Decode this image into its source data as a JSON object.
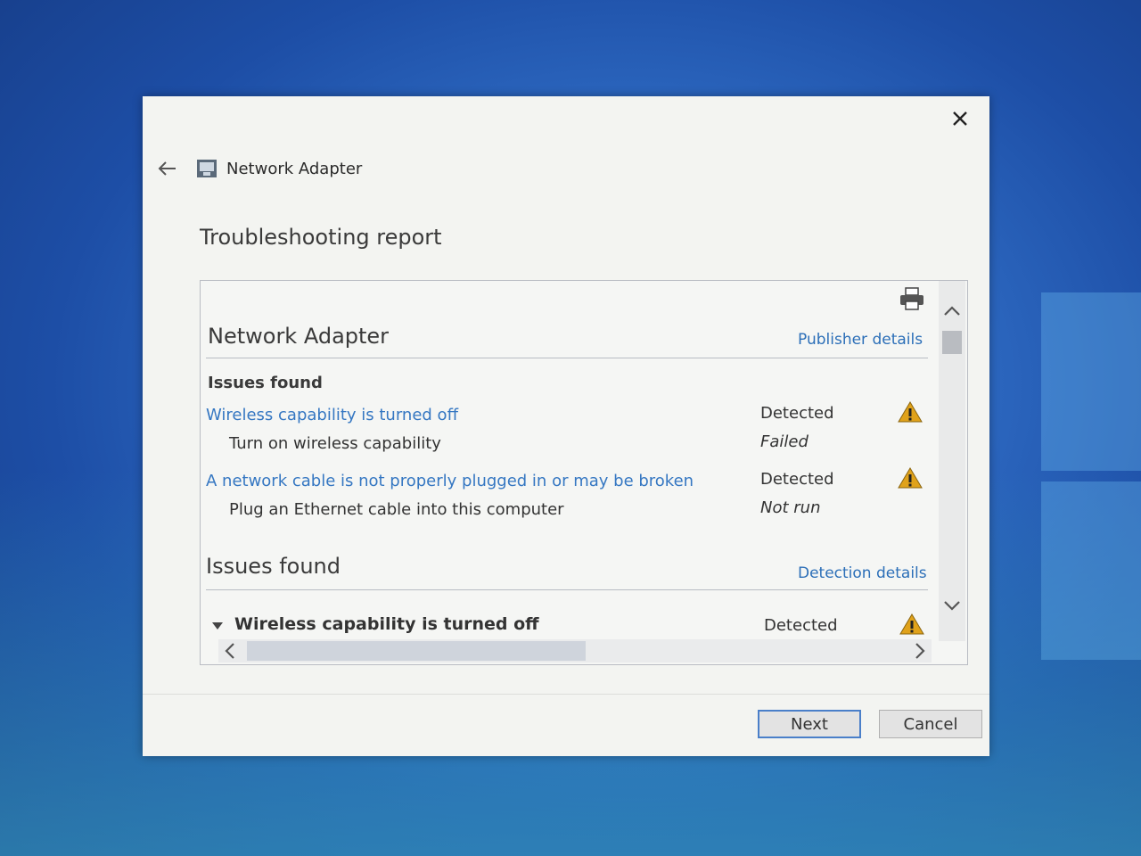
{
  "dialog": {
    "title": "Network Adapter",
    "heading": "Troubleshooting report"
  },
  "report": {
    "section_title": "Network Adapter",
    "publisher_link": "Publisher details",
    "issues_subhead": "Issues found",
    "issues": [
      {
        "problem": "Wireless capability is turned off",
        "problem_status": "Detected",
        "fix": "Turn on wireless capability",
        "fix_status": "Failed"
      },
      {
        "problem": "A network cable is not properly plugged in or may be broken",
        "problem_status": "Detected",
        "fix": "Plug an Ethernet cable into this computer",
        "fix_status": "Not run"
      }
    ],
    "details_section_title": "Issues found",
    "detection_link": "Detection details",
    "detail_row": {
      "label": "Wireless capability is turned off",
      "status": "Detected"
    }
  },
  "buttons": {
    "next": "Next",
    "cancel": "Cancel"
  },
  "icons": [
    "close-icon",
    "back-arrow-icon",
    "network-adapter-icon",
    "printer-icon",
    "warning-icon",
    "expand-triangle-icon",
    "chevron-up-icon",
    "chevron-down-icon",
    "chevron-left-icon",
    "chevron-right-icon"
  ],
  "colors": {
    "link": "#3577c2",
    "warning": "#e0a21a",
    "focus_border": "#4a7fc9"
  }
}
